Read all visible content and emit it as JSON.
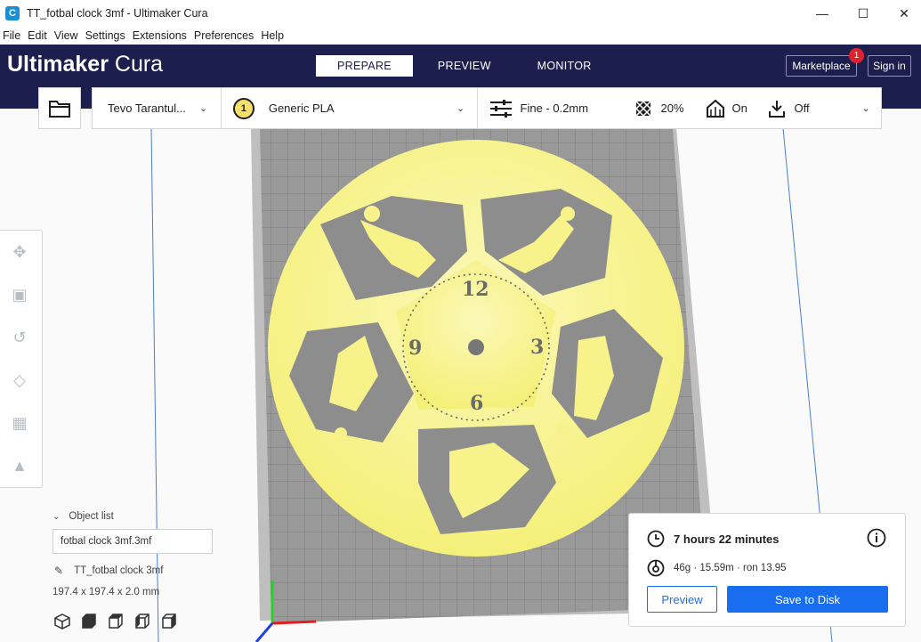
{
  "window": {
    "title": "TT_fotbal clock 3mf - Ultimaker Cura",
    "app_icon_letter": "C",
    "minimize": "—",
    "maximize": "☐",
    "close": "✕"
  },
  "menu": [
    "File",
    "Edit",
    "View",
    "Settings",
    "Extensions",
    "Preferences",
    "Help"
  ],
  "header": {
    "logo_bold": "Ultimaker",
    "logo_light": " Cura",
    "tabs": [
      "PREPARE",
      "PREVIEW",
      "MONITOR"
    ],
    "active_tab": "PREPARE",
    "marketplace_label": "Marketplace",
    "marketplace_badge": "1",
    "signin_label": "Sign in"
  },
  "config": {
    "printer": "Tevo Tarantul...",
    "extruder_number": "1",
    "material": "Generic PLA",
    "profile": "Fine - 0.2mm",
    "infill": "20%",
    "support": "On",
    "adhesion": "Off"
  },
  "object_list": {
    "header": "Object list",
    "filename": "fotbal clock 3mf.3mf",
    "object_name": "TT_fotbal clock 3mf",
    "dimensions": "197.4 x 197.4 x 2.0 mm"
  },
  "print_info": {
    "time": "7 hours 22 minutes",
    "material_usage": "46g · 15.59m · ron 13.95",
    "preview_label": "Preview",
    "save_label": "Save to Disk"
  },
  "clock_numerals": [
    "12",
    "3",
    "6",
    "9"
  ],
  "colors": {
    "header_bg": "#1c1f4d",
    "accent_blue": "#196ef0",
    "model_yellow": "#f7f38a",
    "badge_red": "#e0222d"
  }
}
